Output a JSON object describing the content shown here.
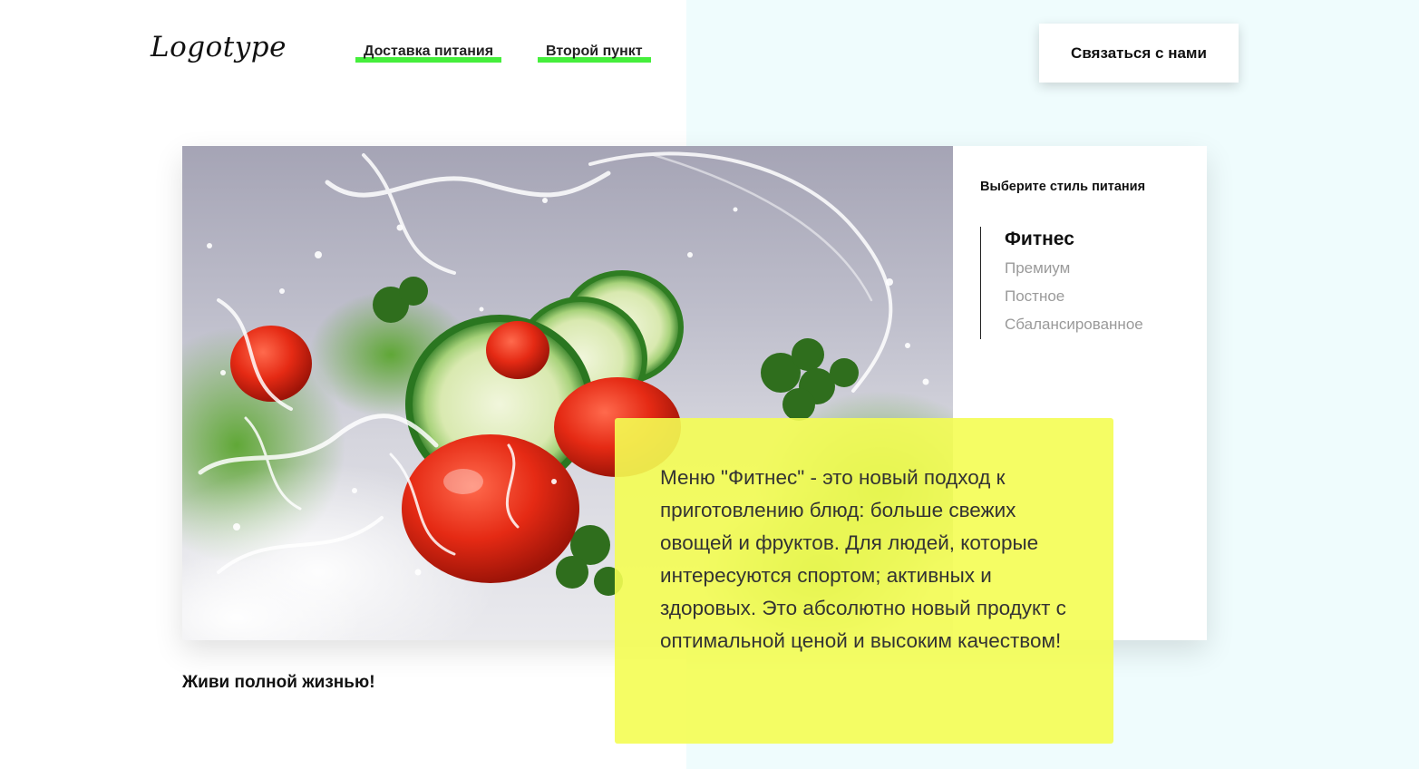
{
  "header": {
    "logo": "Logotype",
    "nav": [
      {
        "label": "Доставка питания"
      },
      {
        "label": "Второй пункт"
      }
    ],
    "contact_button": "Связаться с нами"
  },
  "side_panel": {
    "title": "Выберите стиль питания",
    "styles": [
      {
        "label": "Фитнес",
        "active": true
      },
      {
        "label": "Премиум",
        "active": false
      },
      {
        "label": "Постное",
        "active": false
      },
      {
        "label": "Сбалансированное",
        "active": false
      }
    ]
  },
  "description": "Меню \"Фитнес\" - это новый подход к приготовлению блюд: больше свежих овощей и фруктов. Для людей, которые интересуются спортом; активных и здоровых. Это абсолютно новый продукт с оптимальной ценой и высоким качеством!",
  "tagline": "Живи полной жизнью!",
  "colors": {
    "accent_underline": "#45ef3c",
    "description_bg": "#f4fd53",
    "right_background": "#effcfd"
  }
}
